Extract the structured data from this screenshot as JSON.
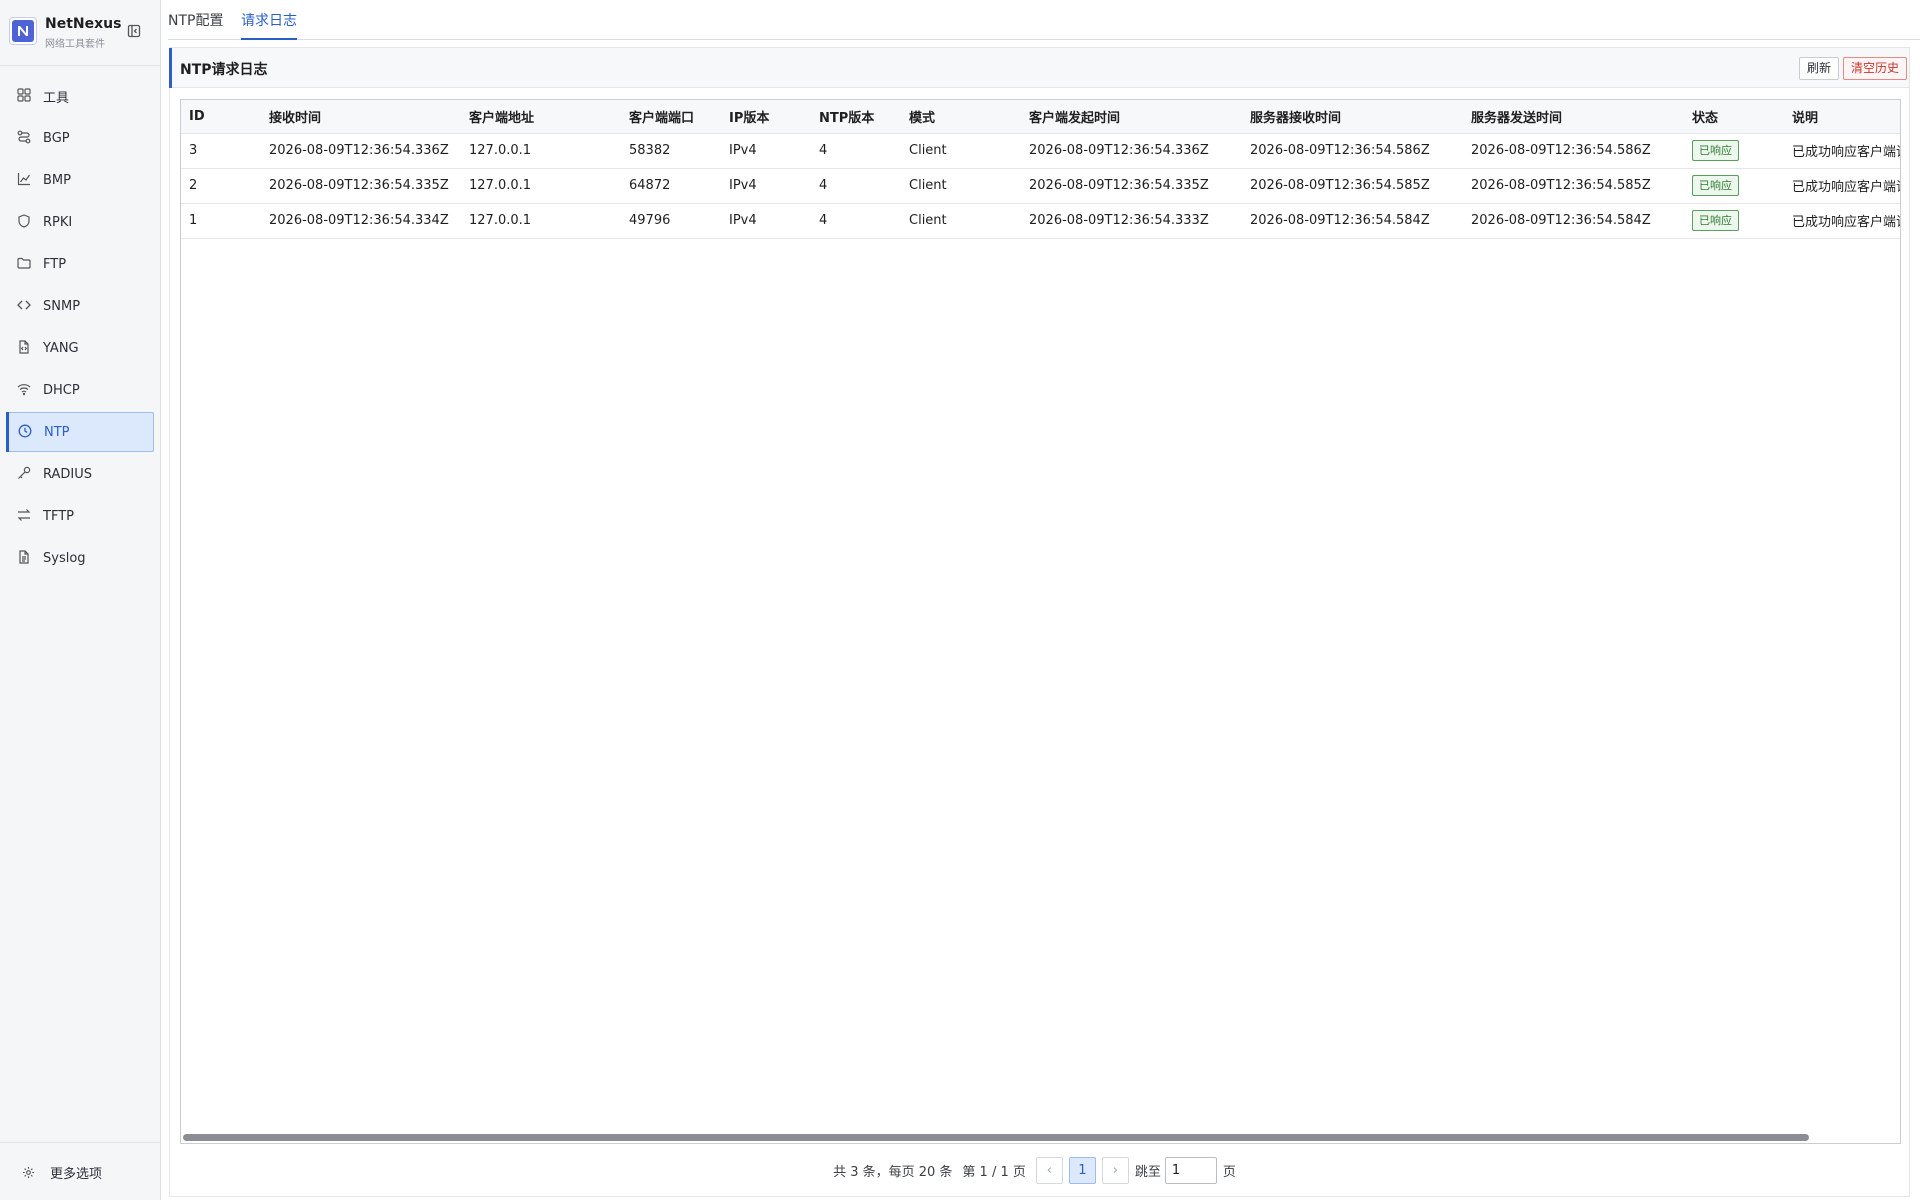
{
  "brand": {
    "name": "NetNexus",
    "subtitle": "网络工具套件"
  },
  "sidebar": {
    "items": [
      {
        "label": "工具",
        "icon": "grid-icon"
      },
      {
        "label": "BGP",
        "icon": "routes-icon"
      },
      {
        "label": "BMP",
        "icon": "chart-icon"
      },
      {
        "label": "RPKI",
        "icon": "shield-icon"
      },
      {
        "label": "FTP",
        "icon": "folder-icon"
      },
      {
        "label": "SNMP",
        "icon": "code-icon"
      },
      {
        "label": "YANG",
        "icon": "file-code-icon"
      },
      {
        "label": "DHCP",
        "icon": "wifi-icon"
      },
      {
        "label": "NTP",
        "icon": "clock-icon",
        "active": true
      },
      {
        "label": "RADIUS",
        "icon": "key-icon"
      },
      {
        "label": "TFTP",
        "icon": "transfer-icon"
      },
      {
        "label": "Syslog",
        "icon": "document-icon"
      }
    ],
    "more_options": "更多选项"
  },
  "tabs": [
    {
      "label": "NTP配置",
      "active": false
    },
    {
      "label": "请求日志",
      "active": true
    }
  ],
  "panel": {
    "title": "NTP请求日志",
    "refresh_label": "刷新",
    "clear_label": "清空历史"
  },
  "table": {
    "columns": [
      "ID",
      "接收时间",
      "客户端地址",
      "客户端端口",
      "IP版本",
      "NTP版本",
      "模式",
      "客户端发起时间",
      "服务器接收时间",
      "服务器发送时间",
      "状态",
      "说明"
    ],
    "rows": [
      [
        "3",
        "2026-08-09T12:36:54.336Z",
        "127.0.0.1",
        "58382",
        "IPv4",
        "4",
        "Client",
        "2026-08-09T12:36:54.336Z",
        "2026-08-09T12:36:54.586Z",
        "2026-08-09T12:36:54.586Z",
        "已响应",
        "已成功响应客户端请求"
      ],
      [
        "2",
        "2026-08-09T12:36:54.335Z",
        "127.0.0.1",
        "64872",
        "IPv4",
        "4",
        "Client",
        "2026-08-09T12:36:54.335Z",
        "2026-08-09T12:36:54.585Z",
        "2026-08-09T12:36:54.585Z",
        "已响应",
        "已成功响应客户端请求"
      ],
      [
        "1",
        "2026-08-09T12:36:54.334Z",
        "127.0.0.1",
        "49796",
        "IPv4",
        "4",
        "Client",
        "2026-08-09T12:36:54.333Z",
        "2026-08-09T12:36:54.584Z",
        "2026-08-09T12:36:54.584Z",
        "已响应",
        "已成功响应客户端请求"
      ]
    ]
  },
  "pagination": {
    "summary": "共 3 条，每页 20 条",
    "page_info": "第 1 / 1 页",
    "prev": "‹",
    "current": "1",
    "next": "›",
    "jump_label": "跳至",
    "jump_value": "1",
    "page_unit": "页"
  },
  "colors": {
    "accent": "#2a5fc8",
    "active_bg": "#dce8fb",
    "success": "#2e7d32",
    "danger": "#c7352d"
  }
}
